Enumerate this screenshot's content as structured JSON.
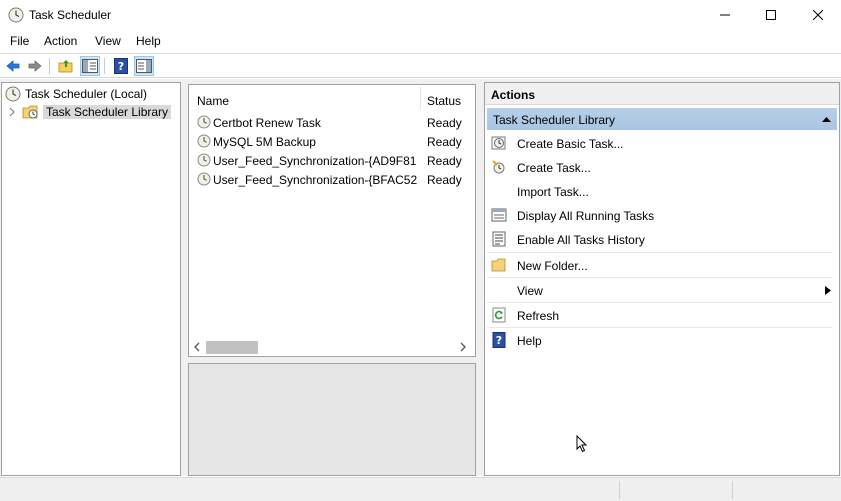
{
  "window": {
    "title": "Task Scheduler",
    "app_icon": "clock-icon"
  },
  "menu": [
    "File",
    "Action",
    "View",
    "Help"
  ],
  "toolbar": {
    "icons": [
      "back-arrow-icon",
      "forward-arrow-icon",
      "up-folder-icon",
      "show-hide-console-tree-icon",
      "help-icon",
      "show-hide-action-pane-icon"
    ]
  },
  "tree": {
    "root": "Task Scheduler (Local)",
    "child": "Task Scheduler Library"
  },
  "list": {
    "columns": [
      "Name",
      "Status"
    ],
    "rows": [
      {
        "name": "Certbot Renew Task",
        "status": "Ready"
      },
      {
        "name": "MySQL 5M Backup",
        "status": "Ready"
      },
      {
        "name": "User_Feed_Synchronization-{AD9F81...",
        "status": "Ready"
      },
      {
        "name": "User_Feed_Synchronization-{BFAC52...",
        "status": "Ready"
      }
    ]
  },
  "actions": {
    "title": "Actions",
    "section": "Task Scheduler Library",
    "items": [
      {
        "label": "Create Basic Task...",
        "icon": "create-basic-task-icon"
      },
      {
        "label": "Create Task...",
        "icon": "create-task-icon"
      },
      {
        "label": "Import Task...",
        "icon": ""
      },
      {
        "label": "Display All Running Tasks",
        "icon": "running-tasks-icon"
      },
      {
        "label": "Enable All Tasks History",
        "icon": "history-icon"
      },
      {
        "label": "New Folder...",
        "icon": "new-folder-icon"
      },
      {
        "label": "View",
        "icon": ""
      },
      {
        "label": "Refresh",
        "icon": "refresh-icon"
      },
      {
        "label": "Help",
        "icon": "help-icon"
      }
    ]
  },
  "colors": {
    "selection_bg": "#d9d9d9",
    "section_header": "#b7cfe8",
    "pane_bg": "#f0f0f0"
  }
}
